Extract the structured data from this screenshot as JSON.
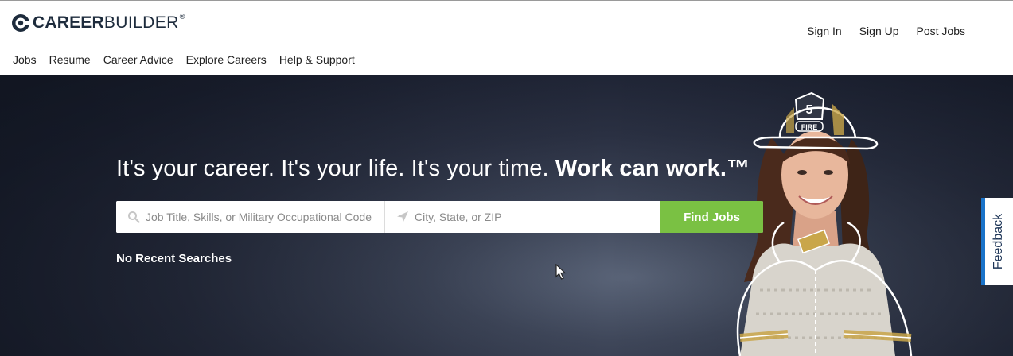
{
  "brand": {
    "logo_text_bold": "CAREER",
    "logo_text_regular": "BUILDER",
    "registered_mark": "®"
  },
  "account_nav": {
    "items": [
      {
        "label": "Sign In"
      },
      {
        "label": "Sign Up"
      },
      {
        "label": "Post Jobs"
      }
    ]
  },
  "main_nav": {
    "items": [
      {
        "label": "Jobs"
      },
      {
        "label": "Resume"
      },
      {
        "label": "Career Advice"
      },
      {
        "label": "Explore Careers"
      },
      {
        "label": "Help & Support"
      }
    ]
  },
  "hero": {
    "tagline_light": "It's your career. It's your life. It's your time.",
    "tagline_bold": "Work can work.™",
    "helmet_number": "5",
    "helmet_label": "FIRE"
  },
  "search": {
    "keywords_placeholder": "Job Title, Skills, or Military Occupational Code",
    "keywords_value": "",
    "location_placeholder": "City, State, or ZIP",
    "location_value": "",
    "submit_label": "Find Jobs"
  },
  "recent_searches": {
    "label": "No Recent Searches"
  },
  "feedback": {
    "label": "Feedback"
  },
  "colors": {
    "accent_green": "#7ac143",
    "feedback_blue": "#1a73c9",
    "hero_dark": "#1b2030"
  }
}
